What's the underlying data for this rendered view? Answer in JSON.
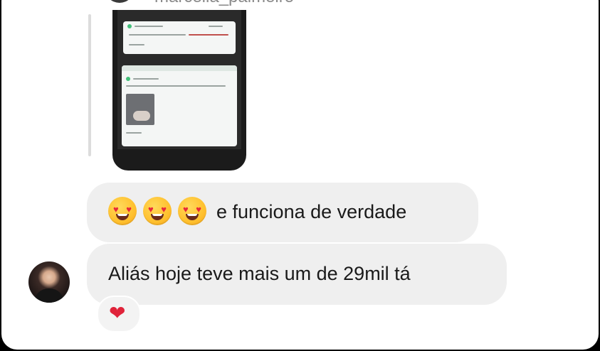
{
  "header": {
    "username": "marcella_palmeiro"
  },
  "shared_screenshot": {
    "icon": "phone-screenshot-thumbnail"
  },
  "messages": [
    {
      "emojis": [
        "heart-eyes-emoji",
        "heart-eyes-emoji",
        "heart-eyes-emoji"
      ],
      "text": "e funciona de verdade"
    },
    {
      "text": "Aliás hoje teve mais um de 29mil tá",
      "reaction": "❤"
    }
  ],
  "colors": {
    "bubble": "#efefef",
    "background": "#ffffff",
    "reaction_heart": "#e0233a"
  }
}
